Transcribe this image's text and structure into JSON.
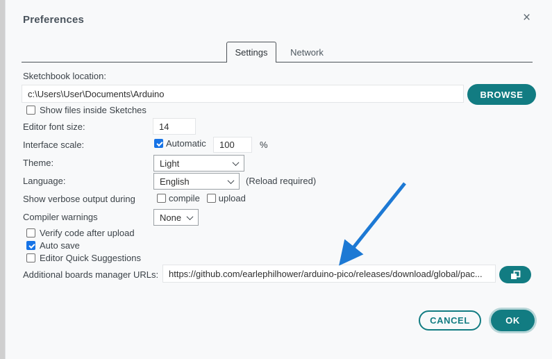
{
  "dialog": {
    "title": "Preferences",
    "close_glyph": "×"
  },
  "tabs": [
    {
      "label": "Settings",
      "active": true
    },
    {
      "label": "Network",
      "active": false
    }
  ],
  "settings": {
    "sketchbook": {
      "label": "Sketchbook location:",
      "value": "c:\\Users\\User\\Documents\\Arduino",
      "browse_label": "BROWSE"
    },
    "show_files": {
      "label": "Show files inside Sketches",
      "checked": false
    },
    "editor_font_size": {
      "label": "Editor font size:",
      "value": "14"
    },
    "interface_scale": {
      "label": "Interface scale:",
      "auto_label": "Automatic",
      "auto_checked": true,
      "value": "100",
      "unit": "%"
    },
    "theme": {
      "label": "Theme:",
      "value": "Light"
    },
    "language": {
      "label": "Language:",
      "value": "English",
      "note": "(Reload required)"
    },
    "verbose": {
      "label": "Show verbose output during",
      "compile": {
        "label": "compile",
        "checked": false
      },
      "upload": {
        "label": "upload",
        "checked": false
      }
    },
    "compiler_warnings": {
      "label": "Compiler warnings",
      "value": "None"
    },
    "toggles": [
      {
        "label": "Verify code after upload",
        "checked": false
      },
      {
        "label": "Auto save",
        "checked": true
      },
      {
        "label": "Editor Quick Suggestions",
        "checked": false
      }
    ],
    "boards_urls": {
      "label": "Additional boards manager URLs:",
      "value": "https://github.com/earlephilhower/arduino-pico/releases/download/global/pac...",
      "icon": "copy-window-icon"
    }
  },
  "footer": {
    "cancel_label": "CANCEL",
    "ok_label": "OK"
  },
  "colors": {
    "accent_teal": "#127c82",
    "checkbox_blue": "#1673e6",
    "arrow_blue": "#1d79d4"
  }
}
